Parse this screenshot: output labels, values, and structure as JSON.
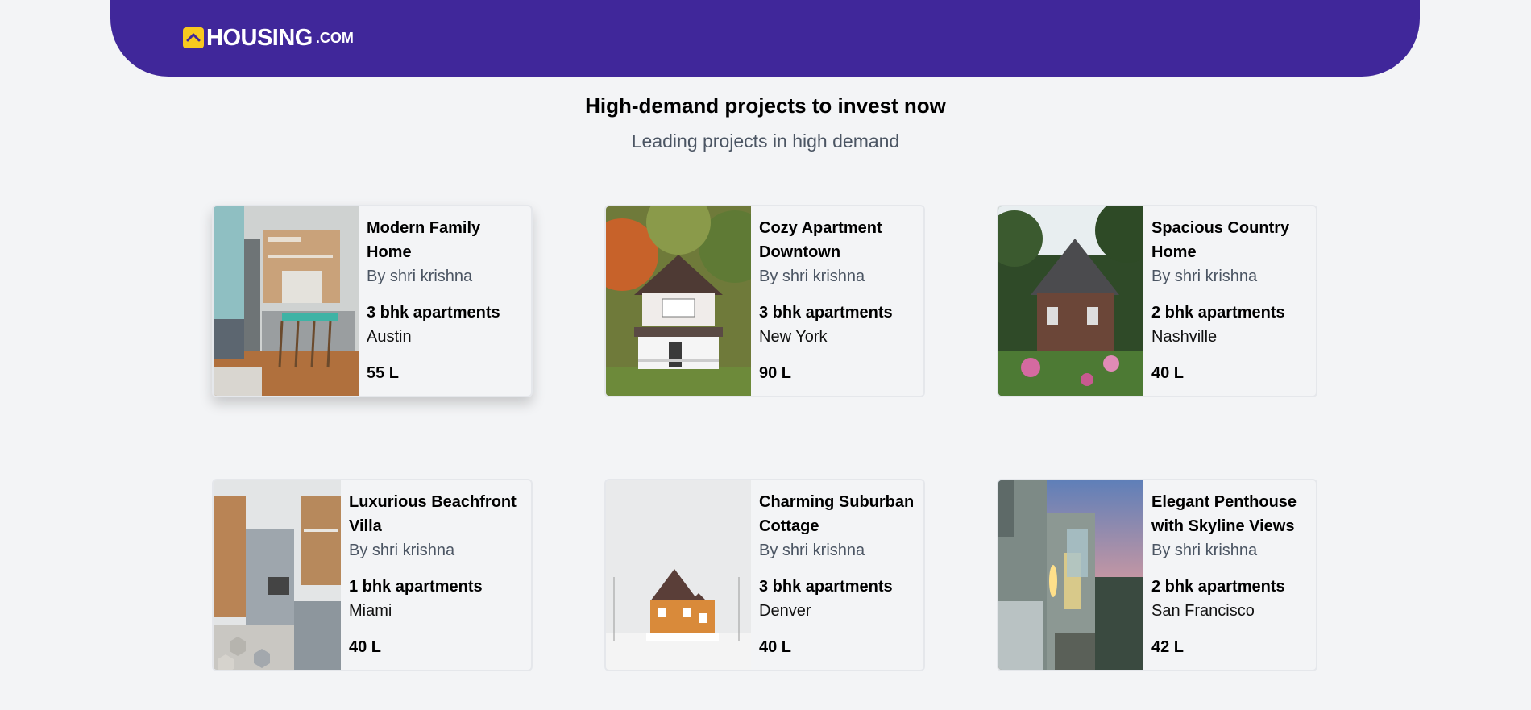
{
  "brand": {
    "name": "HOUSING",
    "suffix": ".COM",
    "accent": "#40279a",
    "badge_color": "#f8c91f"
  },
  "section": {
    "title": "High-demand projects to invest now",
    "subtitle": "Leading projects in high demand"
  },
  "projects": [
    {
      "title_l1": "Modern Family",
      "title_l2": "Home",
      "builder": "By shri krishna",
      "type": "3 bhk apartments",
      "city": "Austin",
      "price": "55 L",
      "image": "modern-kitchen-interior"
    },
    {
      "title_l1": "Cozy Apartment",
      "title_l2": "Downtown",
      "builder": "By shri krishna",
      "type": "3 bhk apartments",
      "city": "New York",
      "price": "90 L",
      "image": "white-house-autumn-trees"
    },
    {
      "title_l1": "Spacious Country",
      "title_l2": "Home",
      "builder": "By shri krishna",
      "type": "2 bhk apartments",
      "city": "Nashville",
      "price": "40 L",
      "image": "stone-cottage-garden"
    },
    {
      "title_l1": "Luxurious Beachfront",
      "title_l2": "Villa",
      "builder": "By shri krishna",
      "type": "1 bhk apartments",
      "city": "Miami",
      "price": "40 L",
      "image": "grey-kitchen-hex-floor"
    },
    {
      "title_l1": "Charming Suburban",
      "title_l2": "Cottage",
      "builder": "By shri krishna",
      "type": "3 bhk apartments",
      "city": "Denver",
      "price": "40 L",
      "image": "victorian-house-snow"
    },
    {
      "title_l1": "Elegant Penthouse",
      "title_l2": "with Skyline Views",
      "builder": "By shri krishna",
      "type": "2 bhk apartments",
      "city": "San Francisco",
      "price": "42 L",
      "image": "modern-house-dusk"
    }
  ]
}
